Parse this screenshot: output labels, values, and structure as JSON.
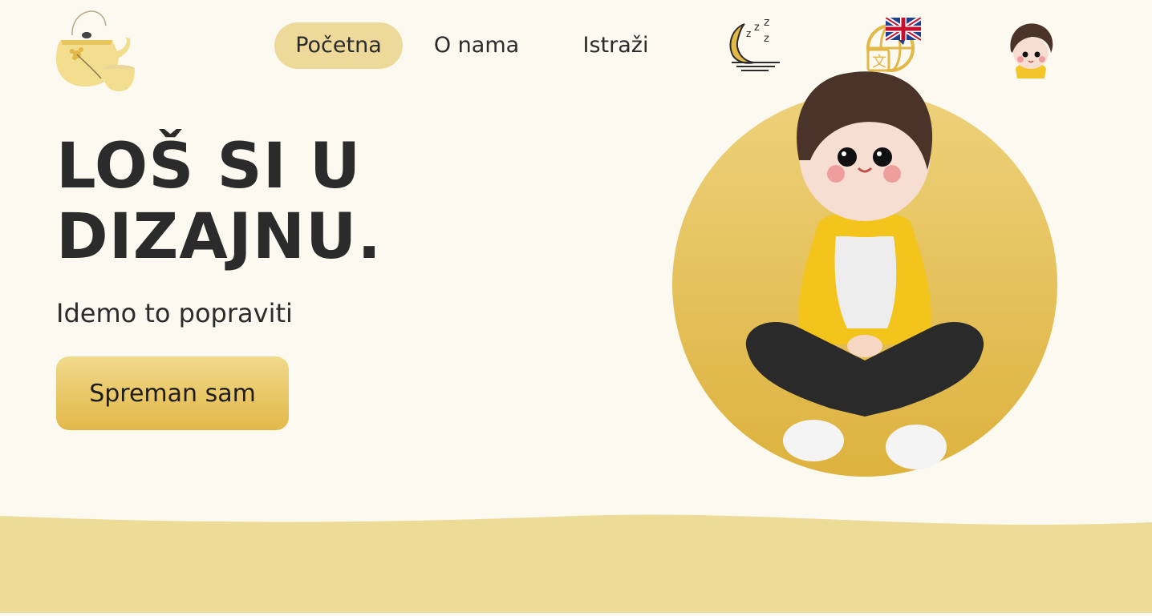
{
  "nav": {
    "items": [
      {
        "label": "Početna",
        "active": true
      },
      {
        "label": "O nama",
        "active": false
      },
      {
        "label": "Istraži",
        "active": false
      }
    ],
    "icons": {
      "logo": "teapot-logo-icon",
      "theme": "moon-sleep-icon",
      "language": "globe-translate-icon",
      "language_flag": "uk-flag-icon",
      "profile": "user-avatar-icon"
    }
  },
  "hero": {
    "title_line1": "LOŠ SI U",
    "title_line2": "DIZAJNU.",
    "subtitle": "Idemo to popraviti",
    "cta_label": "Spreman sam",
    "illustration": "sitting-character-illustration"
  },
  "colors": {
    "background": "#fcf9f0",
    "accent": "#e2b848",
    "accent_light": "#edd99a",
    "text": "#2b2b2b"
  }
}
